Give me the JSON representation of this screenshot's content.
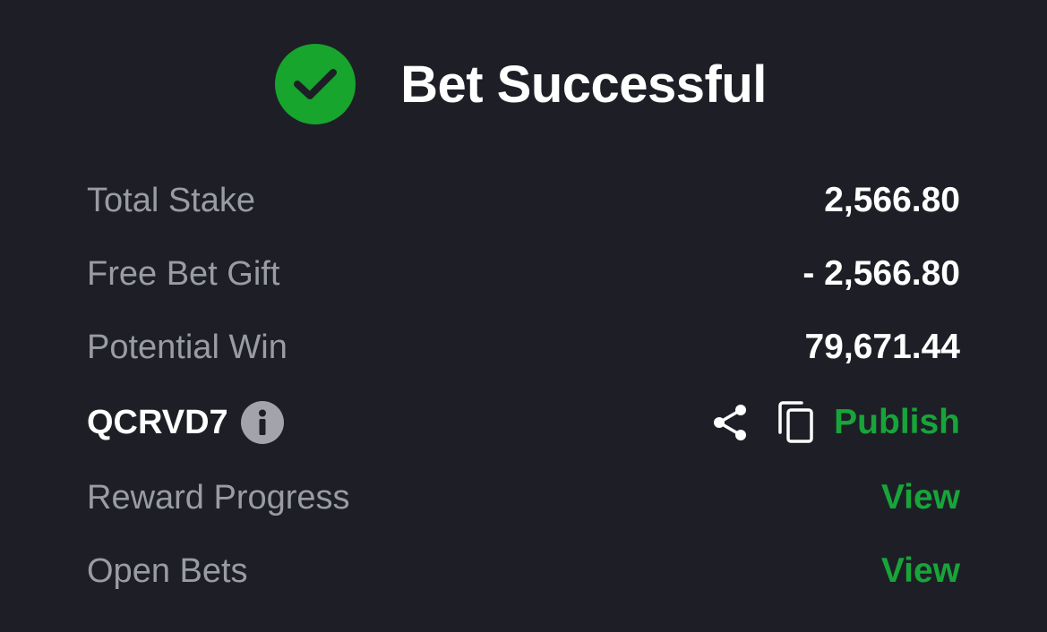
{
  "header": {
    "title": "Bet Successful",
    "status_color": "#17a52e",
    "icon": "check-circle-icon"
  },
  "summary": {
    "total_stake": {
      "label": "Total Stake",
      "value": "2,566.80"
    },
    "free_bet_gift": {
      "label": "Free Bet Gift",
      "value": "- 2,566.80"
    },
    "potential_win": {
      "label": "Potential Win",
      "value": "79,671.44"
    }
  },
  "booking": {
    "code": "QCRVD7",
    "info_icon": "info-icon",
    "share_icon": "share-icon",
    "copy_icon": "copy-icon",
    "publish_label": "Publish"
  },
  "reward_progress": {
    "label": "Reward Progress",
    "link": "View"
  },
  "open_bets": {
    "label": "Open Bets",
    "link": "View"
  },
  "colors": {
    "background": "#1e1f26",
    "accent": "#17a53a",
    "label": "#9a9ca4"
  }
}
